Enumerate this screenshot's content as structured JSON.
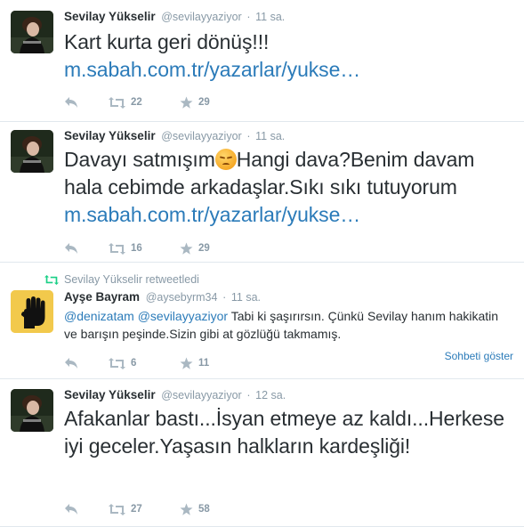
{
  "tweets": [
    {
      "fullname": "Sevilay Yükselir",
      "username": "@sevilayyaziyor",
      "separator": "·",
      "time": "11 sa.",
      "text": "Kart kurta geri dönüş!!!",
      "link": "m.sabah.com.tr/yazarlar/yukse…",
      "retweets": "22",
      "favorites": "29"
    },
    {
      "fullname": "Sevilay Yükselir",
      "username": "@sevilayyaziyor",
      "separator": "·",
      "time": "11 sa.",
      "text_before_emoji": "Davayı satmışım",
      "emoji": "disappointed-face-emoji",
      "text_after_emoji": "Hangi dava?Benim davam hala cebimde arkadaşlar.Sıkı sıkı tutuyorum",
      "link": "m.sabah.com.tr/yazarlar/yukse…",
      "retweets": "16",
      "favorites": "29"
    },
    {
      "retweet_context": "Sevilay Yükselir retweetledi",
      "fullname": "Ayşe Bayram",
      "username": "@aysebyrm34",
      "separator": "·",
      "time": "11 sa.",
      "mention1": "@denizatam",
      "mention2": "@sevilayyaziyor",
      "text": "Tabi ki şaşırırsın. Çünkü Sevilay hanım hakikatin ve barışın peşinde.Sizin gibi at gözlüğü takmamış.",
      "retweets": "6",
      "favorites": "11",
      "show_conversation": "Sohbeti göster"
    },
    {
      "fullname": "Sevilay Yükselir",
      "username": "@sevilayyaziyor",
      "separator": "·",
      "time": "12 sa.",
      "text": "Afakanlar bastı...İsyan etmeye az kaldı...Herkese iyi geceler.Yaşasın halkların kardeşliği!",
      "retweets": "27",
      "favorites": "58"
    }
  ],
  "colors": {
    "link": "#2b7bb9",
    "muted": "#8899a6",
    "text": "#292f33",
    "divider": "#e1e8ed",
    "retweet_icon": "#19cf86"
  }
}
